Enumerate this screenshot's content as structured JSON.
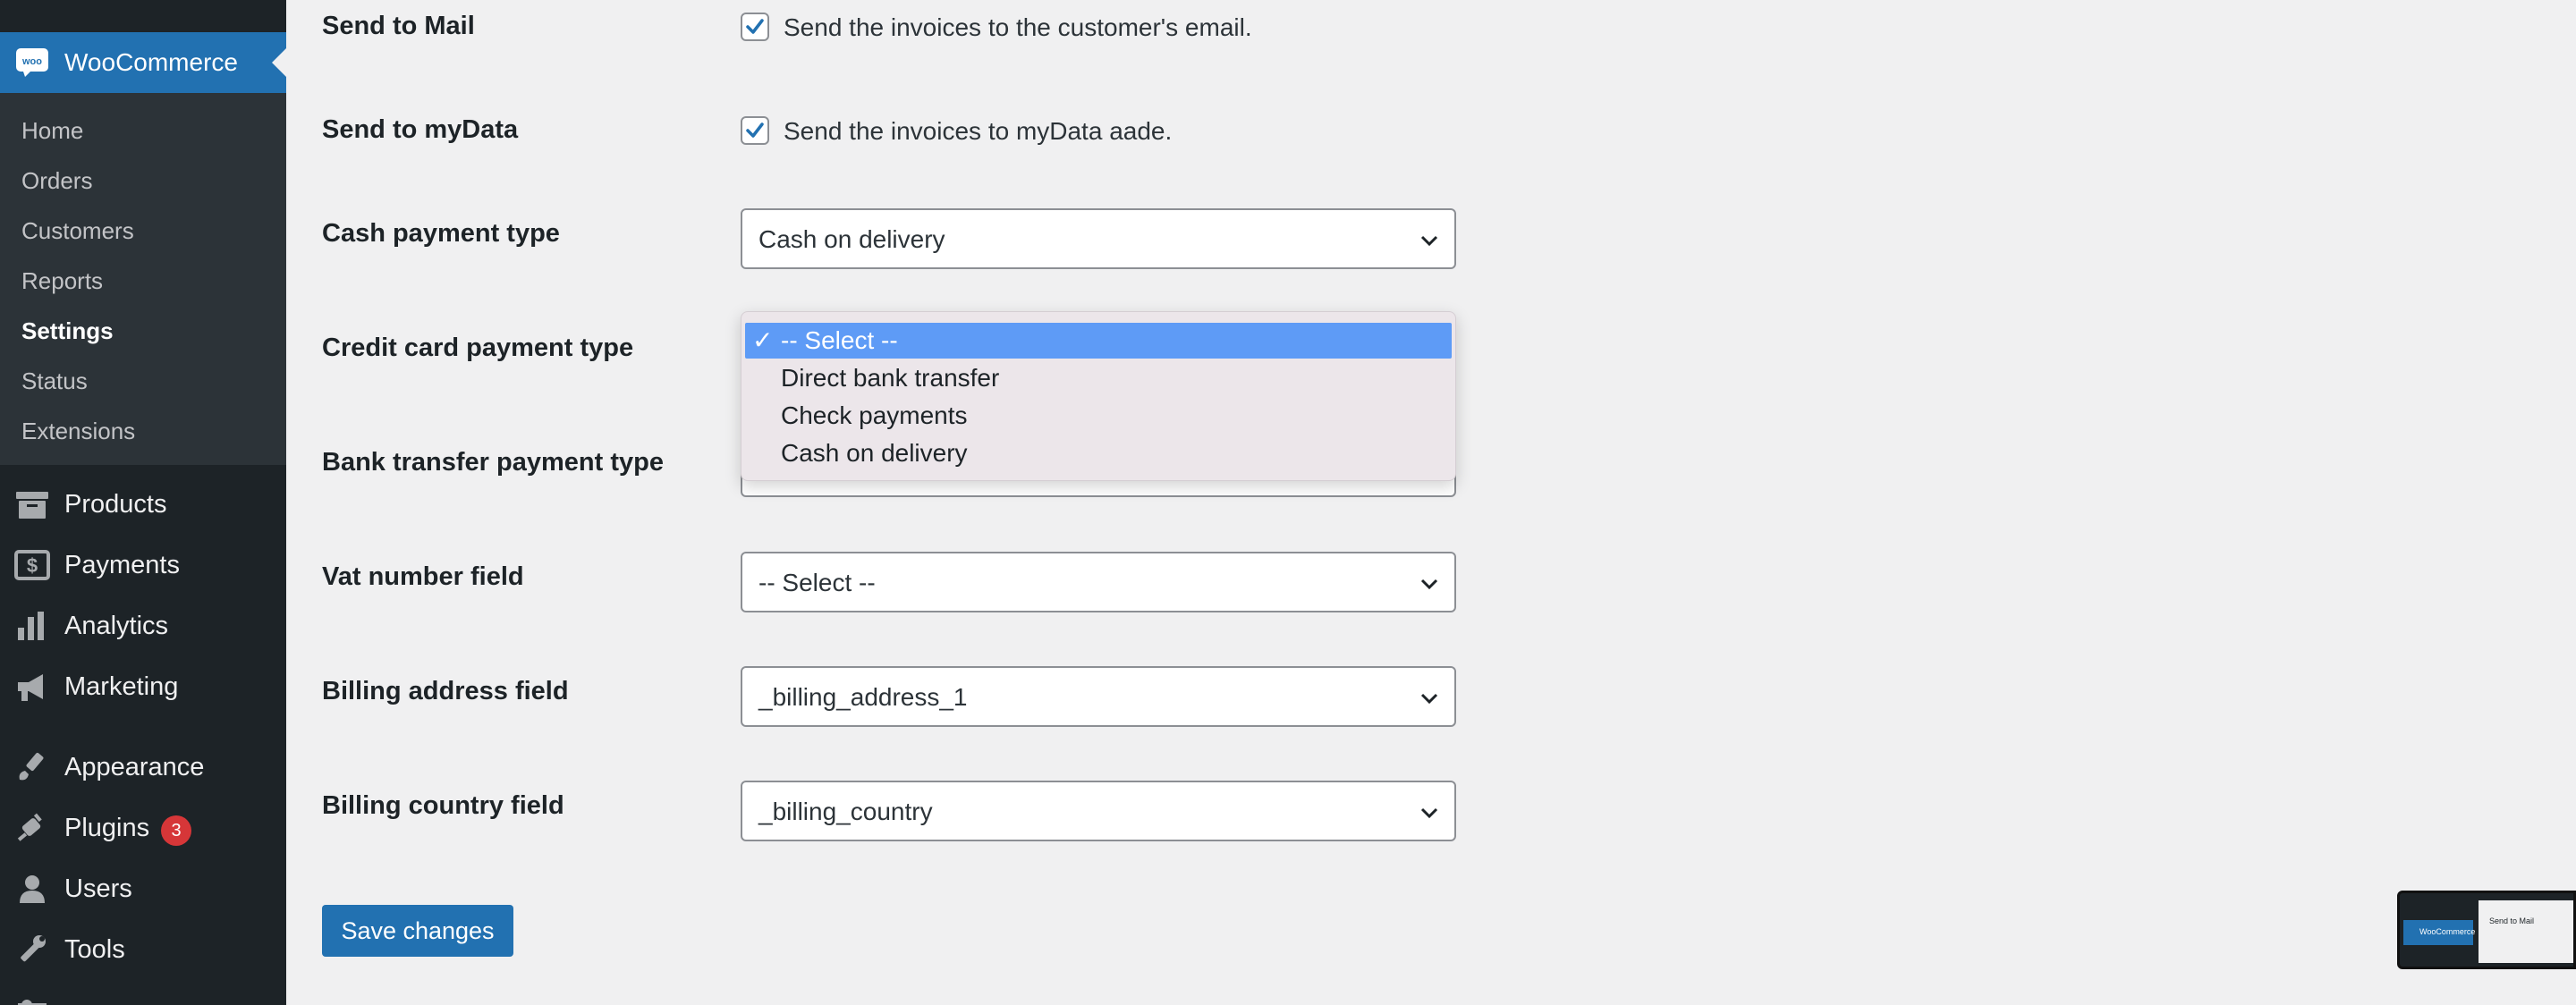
{
  "sidebar": {
    "active_menu": "WooCommerce",
    "submenu": [
      "Home",
      "Orders",
      "Customers",
      "Reports",
      "Settings",
      "Status",
      "Extensions"
    ],
    "current_submenu": "Settings",
    "menu": [
      {
        "label": "Products",
        "icon": "archive-icon"
      },
      {
        "label": "Payments",
        "icon": "dollar-icon"
      },
      {
        "label": "Analytics",
        "icon": "bar-chart-icon"
      },
      {
        "label": "Marketing",
        "icon": "megaphone-icon"
      },
      {
        "label": "Appearance",
        "icon": "paintbrush-icon"
      },
      {
        "label": "Plugins",
        "icon": "plugin-icon",
        "badge": "3"
      },
      {
        "label": "Users",
        "icon": "user-icon"
      },
      {
        "label": "Tools",
        "icon": "wrench-icon"
      }
    ]
  },
  "form": {
    "send_mail": {
      "label": "Send to Mail",
      "checkbox_label": "Send the invoices to the customer's email.",
      "checked": true
    },
    "send_mydata": {
      "label": "Send to myData",
      "checkbox_label": "Send the invoices to myData aade.",
      "checked": true
    },
    "cash_payment": {
      "label": "Cash payment type",
      "value": "Cash on delivery"
    },
    "credit_card_payment": {
      "label": "Credit card payment type",
      "value": "-- Select --",
      "options": [
        "-- Select --",
        "Direct bank transfer",
        "Check payments",
        "Cash on delivery"
      ]
    },
    "bank_transfer_payment": {
      "label": "Bank transfer payment type"
    },
    "vat_field": {
      "label": "Vat number field",
      "value": "-- Select --"
    },
    "billing_address": {
      "label": "Billing address field",
      "value": "_billing_address_1"
    },
    "billing_country": {
      "label": "Billing country field",
      "value": "_billing_country"
    },
    "save_label": "Save changes"
  },
  "dropdown": {
    "checkmark": "✓"
  },
  "thumbnail": {
    "sidebar_text": "WooCommerce",
    "main_text": "Send to Mail"
  },
  "colors": {
    "accent": "#2271b1",
    "sidebar": "#1d2327",
    "highlight": "#5e9bf6",
    "badge": "#d63638"
  }
}
